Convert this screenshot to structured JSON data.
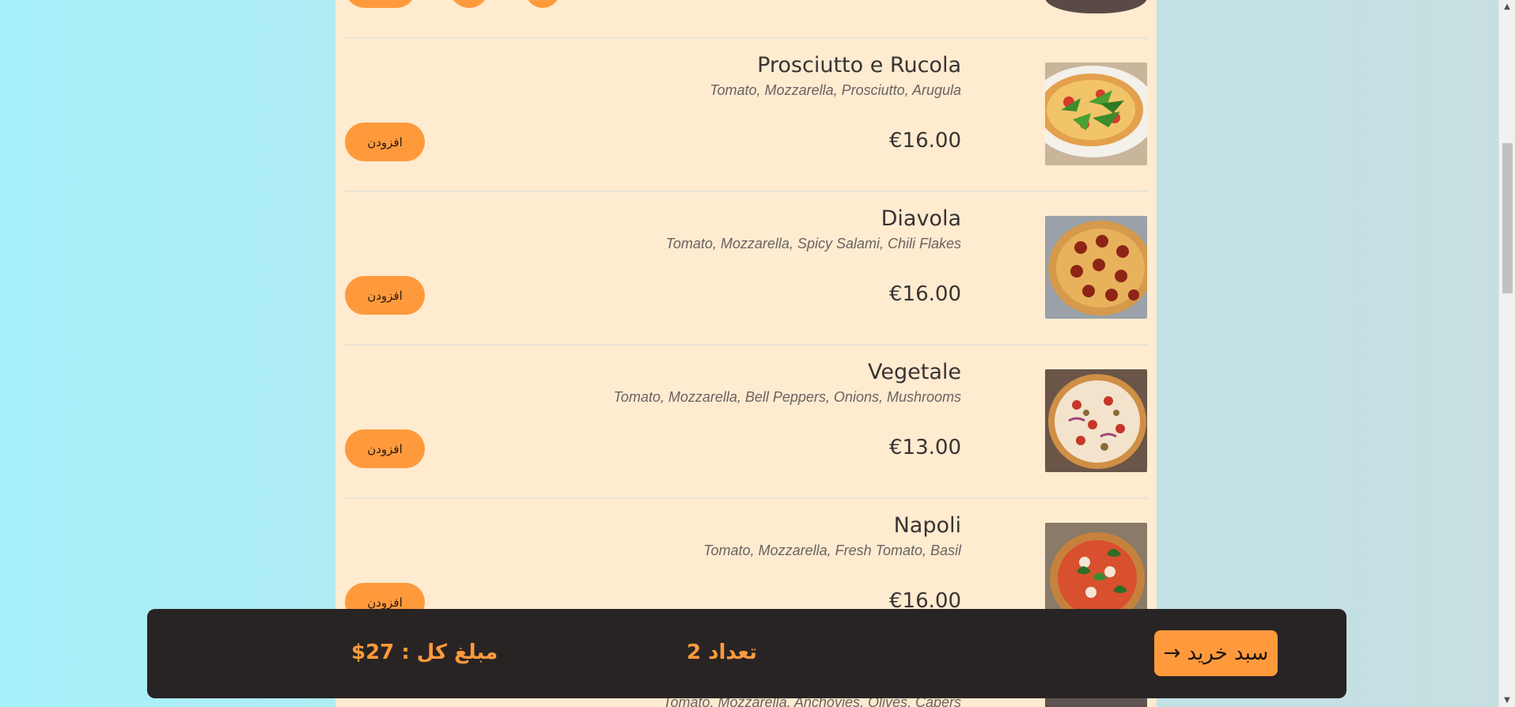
{
  "menu": {
    "items": [
      {
        "name": "Prosciutto e Rucola",
        "description": "Tomato, Mozzarella, Prosciutto, Arugula",
        "price": "€16.00",
        "add_label": "افزودن",
        "image_icon": "pizza-arugula-image"
      },
      {
        "name": "Diavola",
        "description": "Tomato, Mozzarella, Spicy Salami, Chili Flakes",
        "price": "€16.00",
        "add_label": "افزودن",
        "image_icon": "pizza-salami-image"
      },
      {
        "name": "Vegetale",
        "description": "Tomato, Mozzarella, Bell Peppers, Onions, Mushrooms",
        "price": "€13.00",
        "add_label": "افزودن",
        "image_icon": "pizza-vegetable-image"
      },
      {
        "name": "Napoli",
        "description": "Tomato, Mozzarella, Fresh Tomato, Basil",
        "price": "€16.00",
        "add_label": "افزودن",
        "image_icon": "pizza-basil-image"
      }
    ],
    "next_item_description": "Tomato, Mozzarella, Anchovies, Olives, Capers"
  },
  "cart": {
    "button_label": "سبد خرید",
    "button_arrow": "→",
    "count_text": "تعداد 2",
    "total_text": "مبلغ کل : 27$"
  },
  "colors": {
    "accent": "#ff9a3c",
    "panel": "#feebd0",
    "cartbar": "#292424"
  }
}
